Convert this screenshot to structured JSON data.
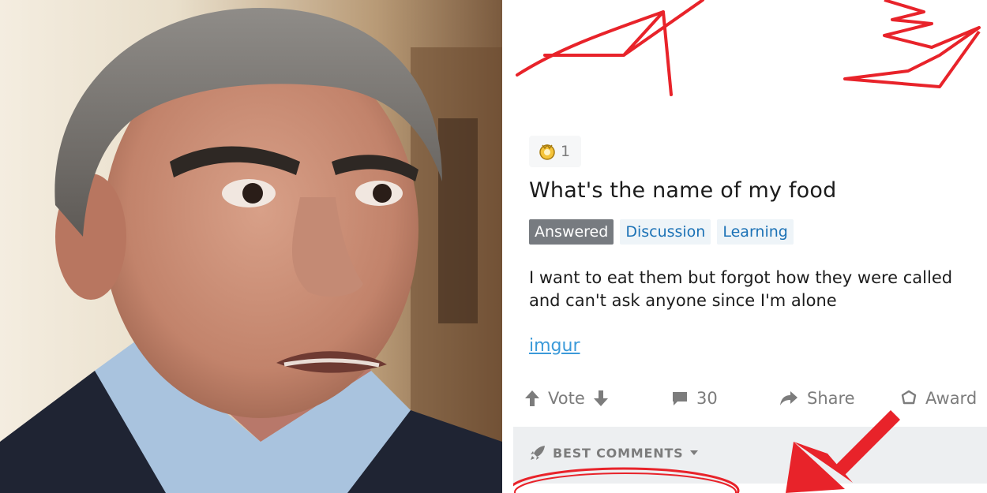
{
  "post": {
    "award_count": "1",
    "title": "What's the name of my food",
    "flairs": [
      "Answered",
      "Discussion",
      "Learning"
    ],
    "body": "I want to eat them but forgot how they were called and can't ask anyone since I'm alone",
    "link_text": "imgur",
    "actions": {
      "vote": "Vote",
      "comments": "30",
      "share": "Share",
      "award": "Award"
    },
    "sort_label": "BEST COMMENTS"
  },
  "colors": {
    "annotation_red": "#e8232a",
    "flair_answered_bg": "#777b80",
    "flair_tag_text": "#1c72b6",
    "link": "#3b9ad9",
    "comments_bar_bg": "#edeff1"
  },
  "icons": {
    "award": "award-badge-icon",
    "upvote": "arrow-up-icon",
    "downvote": "arrow-down-icon",
    "comments": "comment-bubble-icon",
    "share": "share-arrow-icon",
    "give_award": "award-outline-icon",
    "sort": "rocket-icon",
    "dropdown": "caret-down-icon"
  }
}
